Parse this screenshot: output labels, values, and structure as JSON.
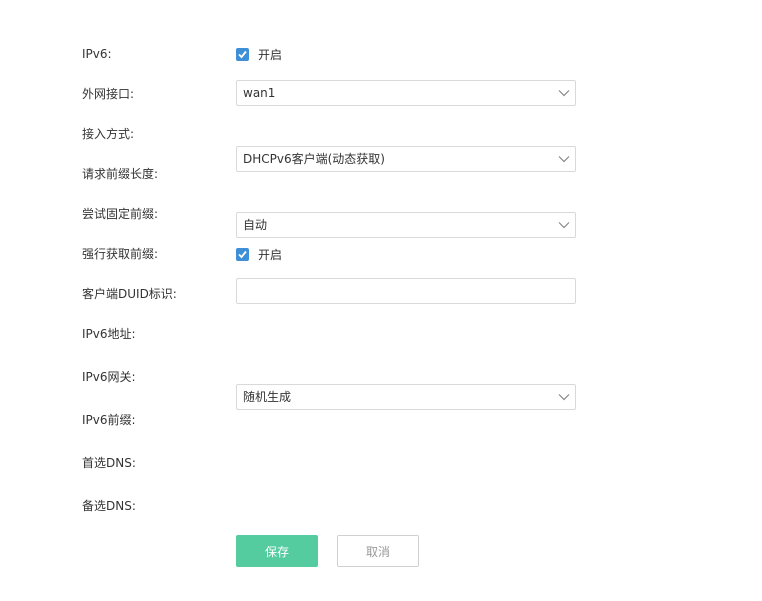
{
  "form": {
    "ipv6": {
      "label": "IPv6:",
      "checkbox_label": "开启",
      "checked": true
    },
    "wan_interface": {
      "label": "外网接口:",
      "value": "wan1"
    },
    "access_mode": {
      "label": "接入方式:",
      "value": "DHCPv6客户端(动态获取)"
    },
    "prefix_length": {
      "label": "请求前缀长度:",
      "value": "自动"
    },
    "fixed_prefix": {
      "label": "尝试固定前缀:",
      "value": ""
    },
    "force_prefix": {
      "label": "强行获取前缀:",
      "checkbox_label": "开启",
      "checked": true
    },
    "duid": {
      "label": "客户端DUID标识:",
      "value": "随机生成"
    },
    "ipv6_address": {
      "label": "IPv6地址:"
    },
    "ipv6_gateway": {
      "label": "IPv6网关:"
    },
    "ipv6_prefix": {
      "label": "IPv6前缀:"
    },
    "primary_dns": {
      "label": "首选DNS:"
    },
    "secondary_dns": {
      "label": "备选DNS:"
    }
  },
  "buttons": {
    "save": "保存",
    "cancel": "取消"
  },
  "colors": {
    "checkbox": "#3f8fd6",
    "save_button": "#55cba0",
    "border": "#d9d9d9"
  }
}
